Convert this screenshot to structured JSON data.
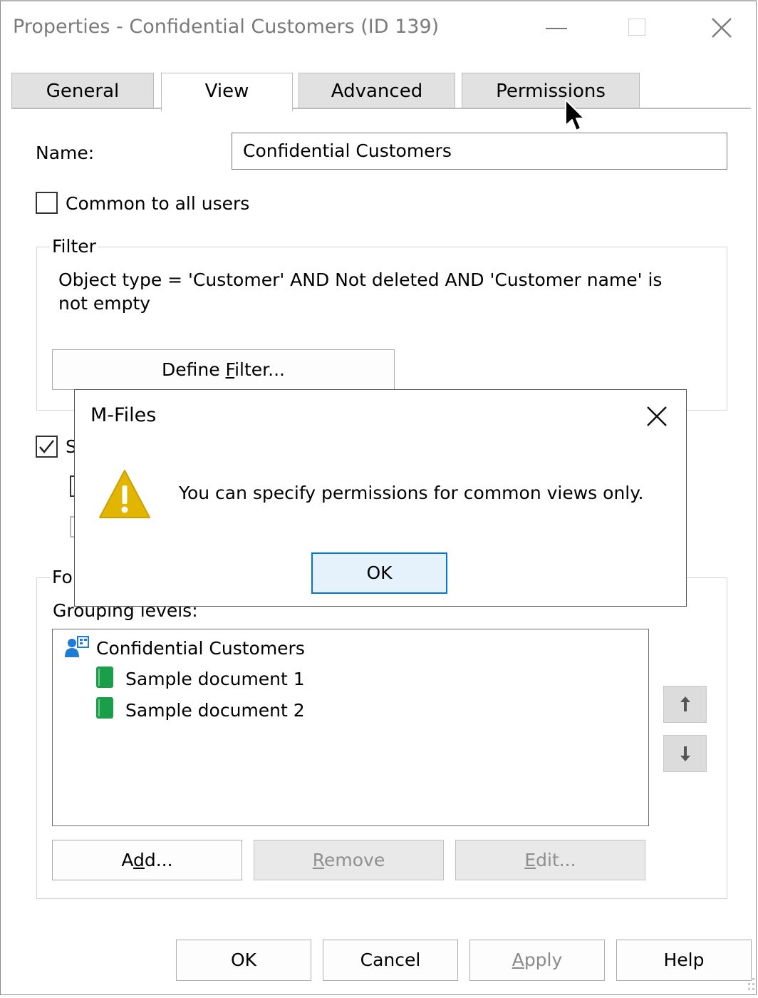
{
  "window": {
    "title": "Properties - Confidential Customers (ID 139)"
  },
  "tabs": [
    {
      "label": "General",
      "active": false
    },
    {
      "label": "View",
      "active": true
    },
    {
      "label": "Advanced",
      "active": false
    },
    {
      "label": "Permissions",
      "active": false
    }
  ],
  "form": {
    "name_label": "Name:",
    "name_value": "Confidential Customers",
    "common_label": "Common to all users",
    "common_checked": false
  },
  "filter": {
    "group_title": "Filter",
    "text_line1": "Object type = 'Customer' AND Not deleted AND 'Customer name' is",
    "text_line2": "not empty",
    "define_pre": "Define ",
    "define_accel": "F",
    "define_post": "ilter..."
  },
  "partial": {
    "checkbox_letter": "S",
    "folders_title_fragment": "Fo"
  },
  "folders": {
    "grouping_label": "Grouping levels:",
    "tree": [
      {
        "label": "Confidential Customers",
        "icon": "view-icon"
      },
      {
        "label": "Sample document 1",
        "icon": "document-icon"
      },
      {
        "label": "Sample document 2",
        "icon": "document-icon"
      }
    ],
    "add_pre": "A",
    "add_accel": "d",
    "add_post": "d...",
    "remove_accel": "R",
    "remove_post": "emove",
    "edit_accel": "E",
    "edit_post": "dit..."
  },
  "footer": {
    "ok": "OK",
    "cancel": "Cancel",
    "apply_accel": "A",
    "apply_post": "pply",
    "help": "Help"
  },
  "modal": {
    "title": "M-Files",
    "message": "You can specify permissions for common views only.",
    "ok": "OK",
    "icon": "warning-icon"
  },
  "colors": {
    "accent": "#0078d7",
    "warning": "#e2b600"
  }
}
